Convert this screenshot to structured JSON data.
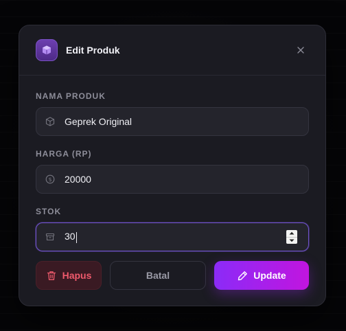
{
  "modal": {
    "title": "Edit Produk",
    "header_icon": "cube-icon",
    "close_icon": "close-icon"
  },
  "fields": {
    "name": {
      "label": "NAMA PRODUK",
      "value": "Geprek Original",
      "icon": "package-icon"
    },
    "price": {
      "label": "HARGA (RP)",
      "value": "20000",
      "icon": "dollar-circle-icon"
    },
    "stock": {
      "label": "STOK",
      "value": "30",
      "icon": "archive-box-icon"
    }
  },
  "actions": {
    "delete_label": "Hapus",
    "cancel_label": "Batal",
    "update_label": "Update"
  },
  "colors": {
    "accent_start": "#8b2bf7",
    "accent_end": "#c115df",
    "danger": "#ef5a6c",
    "modal_bg": "#1b1b22"
  }
}
